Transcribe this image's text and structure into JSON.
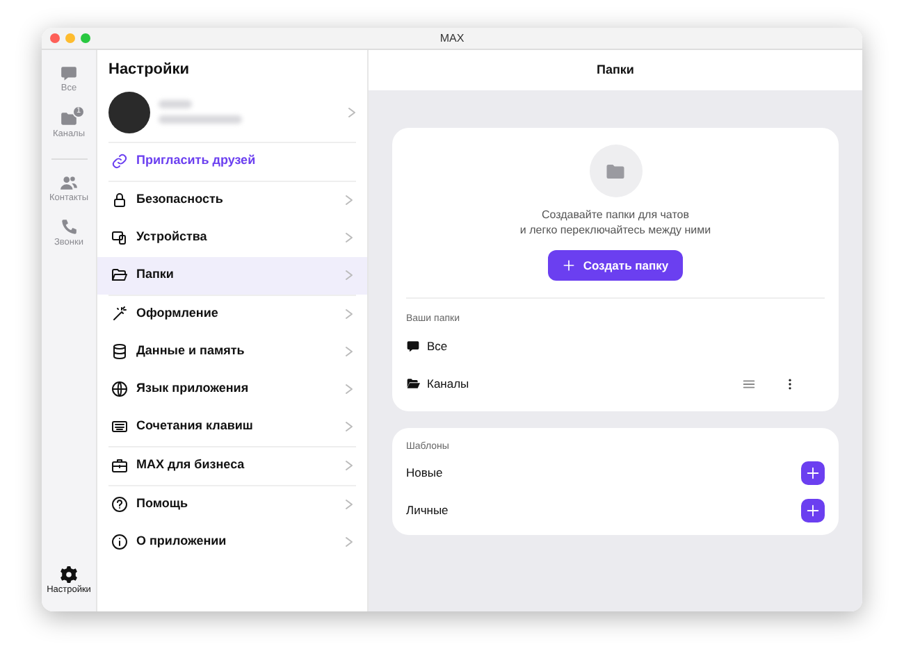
{
  "window": {
    "title": "MAX"
  },
  "rail": {
    "items": [
      {
        "label": "Все",
        "selected": false
      },
      {
        "label": "Каналы",
        "badge": "1",
        "selected": false
      },
      {
        "label": "Контакты",
        "selected": false
      },
      {
        "label": "Звонки",
        "selected": false
      }
    ],
    "footer": {
      "label": "Настройки",
      "selected": true
    }
  },
  "settings": {
    "title": "Настройки",
    "invite": "Пригласить друзей",
    "groups": [
      [
        {
          "label": "Безопасность",
          "selected": false
        },
        {
          "label": "Устройства",
          "selected": false
        },
        {
          "label": "Папки",
          "selected": true
        }
      ],
      [
        {
          "label": "Оформление",
          "selected": false
        },
        {
          "label": "Данные и память",
          "selected": false
        },
        {
          "label": "Язык приложения",
          "selected": false
        },
        {
          "label": "Сочетания клавиш",
          "selected": false
        }
      ],
      [
        {
          "label": "MAX для бизнеса",
          "selected": false
        }
      ],
      [
        {
          "label": "Помощь",
          "selected": false
        },
        {
          "label": "О приложении",
          "selected": false
        }
      ]
    ]
  },
  "main": {
    "header": "Папки",
    "empty_text": [
      "Создавайте папки для чатов",
      "и легко переключайтесь между ними"
    ],
    "create_button": "Создать папку",
    "folders_title": "Ваши папки",
    "folders": [
      {
        "name": "Все",
        "editable": false
      },
      {
        "name": "Каналы",
        "editable": true
      }
    ],
    "templates_title": "Шаблоны",
    "templates": [
      {
        "name": "Новые"
      },
      {
        "name": "Личные"
      }
    ]
  }
}
